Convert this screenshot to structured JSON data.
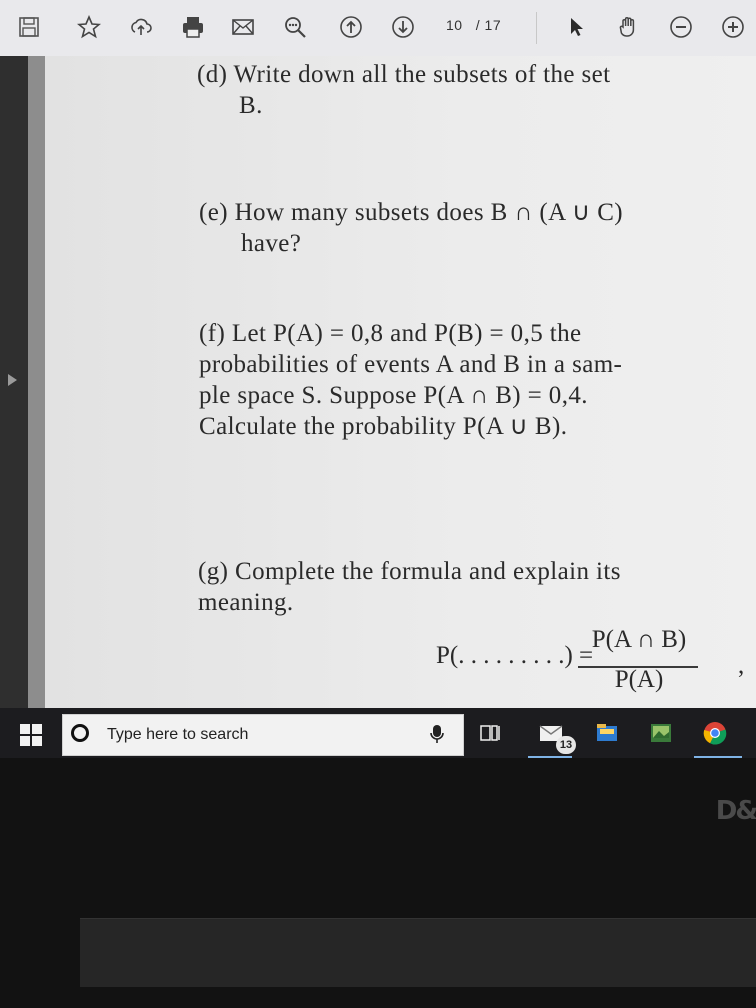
{
  "toolbar": {
    "page_current": "10",
    "page_separator": "/",
    "page_total": "17",
    "icons": [
      "save-icon",
      "bookmark-star-icon",
      "cloud-upload-icon",
      "print-icon",
      "email-icon",
      "zoom-search-icon",
      "page-up-icon",
      "page-down-icon",
      "select-cursor-icon",
      "hand-pan-icon",
      "zoom-out-icon",
      "zoom-in-icon"
    ]
  },
  "document": {
    "q_d_line1": "(d) Write down all the subsets of the set",
    "q_d_line2": "B.",
    "q_e_line1": "(e) How many subsets does B ∩ (A ∪ C)",
    "q_e_line2": "have?",
    "q_f_line1": "(f) Let P(A) = 0,8 and P(B) = 0,5 the",
    "q_f_line2": "probabilities of events A and B in a sam-",
    "q_f_line3": "ple space S. Suppose P(A ∩ B) = 0,4.",
    "q_f_line4": "Calculate the probability P(A ∪ B).",
    "q_g_line1": "(g) Complete the formula and explain its",
    "q_g_line2": "meaning.",
    "formula_left": "P(. . . . . . . . .) =",
    "formula_numerator": "P(A ∩ B)",
    "formula_denominator": "P(A)",
    "formula_comma": ","
  },
  "taskbar": {
    "search_placeholder": "Type here to search",
    "mail_badge": "13",
    "icons": [
      "windows-start-icon",
      "cortana-circle-icon",
      "microphone-icon",
      "task-view-icon",
      "mail-app-icon",
      "file-explorer-icon",
      "photos-app-icon",
      "chrome-icon"
    ]
  },
  "device": {
    "brand_text": "D&"
  },
  "colors": {
    "toolbar_bg": "#e9e9ec",
    "page_bg": "#ececec",
    "taskbar_bg": "#1c1c1f",
    "accent_blue": "#2e7bcf"
  }
}
